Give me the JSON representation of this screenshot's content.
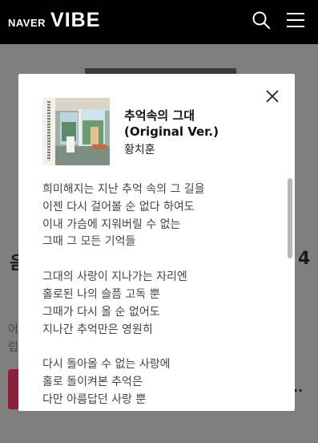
{
  "header": {
    "logo_naver": "NAVER",
    "logo_vibe": "VIBE",
    "search_icon": "search-icon",
    "menu_icon": "hamburger-menu-icon",
    "background_color": "#000000"
  },
  "background_page": {
    "title_left_fragment": "음",
    "title_right_fragment": "4",
    "text_left_fragment": "어 럽",
    "more_fragment": ".."
  },
  "modal": {
    "song_title": "추억속의 그대 (Original Ver.)",
    "artist": "황치훈",
    "close_icon": "close-icon",
    "lyrics": [
      [
        "희미해지는 지난 추억 속의 그 길을",
        "이젠 다시 걸어볼 순 없다 하여도",
        "이내 가슴에 지워버릴 수 없는",
        "그때 그 모든 기억들"
      ],
      [
        "그대의 사랑이 지나가는 자리엔",
        "홀로된 나의 슬픔 고독 뿐",
        "그때가 다시 올 순 없어도",
        "지나간 추억만은 영원히"
      ],
      [
        "다시 돌아올 수 없는 사랑에",
        "홀로 돌이켜본 추억은",
        "다만 아름답던 사랑 뿐"
      ]
    ],
    "scroll_position": 0.0
  },
  "colors": {
    "overlay": "#7f7f7f",
    "accent": "#8c1f3e",
    "lyric_text": "#444444"
  }
}
